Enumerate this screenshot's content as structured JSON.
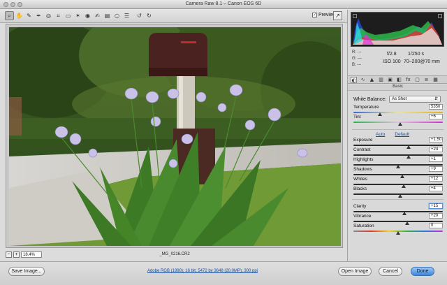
{
  "window": {
    "title": "Camera Raw 8.1  –  Canon EOS 6D"
  },
  "toolbar": {
    "tools": [
      {
        "icon": "zoom-icon",
        "glyph": "⌕",
        "active": true
      },
      {
        "icon": "hand-icon",
        "glyph": "✋",
        "active": false
      },
      {
        "icon": "white-balance-icon",
        "glyph": "✎",
        "active": false
      },
      {
        "icon": "color-sampler-icon",
        "glyph": "✒",
        "active": false
      },
      {
        "icon": "targeted-adjustment-icon",
        "glyph": "◎",
        "active": false
      },
      {
        "icon": "crop-icon",
        "glyph": "⌗",
        "active": false
      },
      {
        "icon": "straighten-icon",
        "glyph": "▭",
        "active": false
      },
      {
        "icon": "spot-removal-icon",
        "glyph": "✶",
        "active": false
      },
      {
        "icon": "red-eye-icon",
        "glyph": "◉",
        "active": false
      },
      {
        "icon": "adjustment-brush-icon",
        "glyph": "✍",
        "active": false
      },
      {
        "icon": "graduated-filter-icon",
        "glyph": "▤",
        "active": false
      },
      {
        "icon": "radial-filter-icon",
        "glyph": "○",
        "active": false
      },
      {
        "icon": "preferences-icon",
        "glyph": "☰",
        "active": false
      },
      {
        "icon": "rotate-left-icon",
        "glyph": "↺",
        "active": false
      },
      {
        "icon": "rotate-right-icon",
        "glyph": "↻",
        "active": false
      }
    ],
    "preview_label": "Preview",
    "preview_checked": "✓"
  },
  "zoom": {
    "value": "18.4%",
    "minus": "−",
    "plus": "+"
  },
  "filename": "_MG_0216.CR2",
  "readout": {
    "r": "R:  ---",
    "g": "G:  ---",
    "b": "B:  ---",
    "aperture": "f/2.8",
    "shutter": "1/250 s",
    "iso": "ISO 100",
    "lens": "70–200@70 mm"
  },
  "panel_tabs": [
    {
      "icon": "basic-tab-icon",
      "glyph": "◐",
      "active": true
    },
    {
      "icon": "tone-curve-tab-icon",
      "glyph": "∿",
      "active": false
    },
    {
      "icon": "detail-tab-icon",
      "glyph": "▲",
      "active": false
    },
    {
      "icon": "hsl-tab-icon",
      "glyph": "▥",
      "active": false
    },
    {
      "icon": "split-toning-tab-icon",
      "glyph": "▣",
      "active": false
    },
    {
      "icon": "lens-corrections-tab-icon",
      "glyph": "◧",
      "active": false
    },
    {
      "icon": "effects-tab-icon",
      "glyph": "fx",
      "active": false
    },
    {
      "icon": "camera-calibration-tab-icon",
      "glyph": "▢",
      "active": false
    },
    {
      "icon": "presets-tab-icon",
      "glyph": "≡",
      "active": false
    },
    {
      "icon": "snapshots-tab-icon",
      "glyph": "▦",
      "active": false
    }
  ],
  "basic": {
    "title": "Basic",
    "wb_label": "White Balance:",
    "wb_value": "As Shot",
    "auto": "Auto",
    "default": "Default",
    "sliders": [
      {
        "label": "Temperature",
        "value": "5350",
        "pos": 0.3,
        "track": "temp"
      },
      {
        "label": "Tint",
        "value": "+6",
        "pos": 0.52,
        "track": "tint"
      },
      {
        "label": "Exposure",
        "value": "+1.50",
        "pos": 0.62,
        "track": "plain"
      },
      {
        "label": "Contrast",
        "value": "+24",
        "pos": 0.62,
        "track": "plain"
      },
      {
        "label": "Highlights",
        "value": "+1",
        "pos": 0.5,
        "track": "plain"
      },
      {
        "label": "Shadows",
        "value": "+9",
        "pos": 0.55,
        "track": "plain"
      },
      {
        "label": "Whites",
        "value": "+12",
        "pos": 0.56,
        "track": "plain"
      },
      {
        "label": "Blacks",
        "value": "+4",
        "pos": 0.52,
        "track": "plain"
      },
      {
        "label": "Clarity",
        "value": "+15",
        "pos": 0.57,
        "track": "plain",
        "highlight": true
      },
      {
        "label": "Vibrance",
        "value": "+20",
        "pos": 0.6,
        "track": "plain"
      },
      {
        "label": "Saturation",
        "value": "0",
        "pos": 0.5,
        "track": "sat"
      }
    ]
  },
  "bottom": {
    "save": "Save Image...",
    "workflow": "Adobe RGB (1998); 16 bit; 5472 by 3648 (20.0MP); 300 ppi",
    "open": "Open Image",
    "cancel": "Cancel",
    "done": "Done"
  }
}
